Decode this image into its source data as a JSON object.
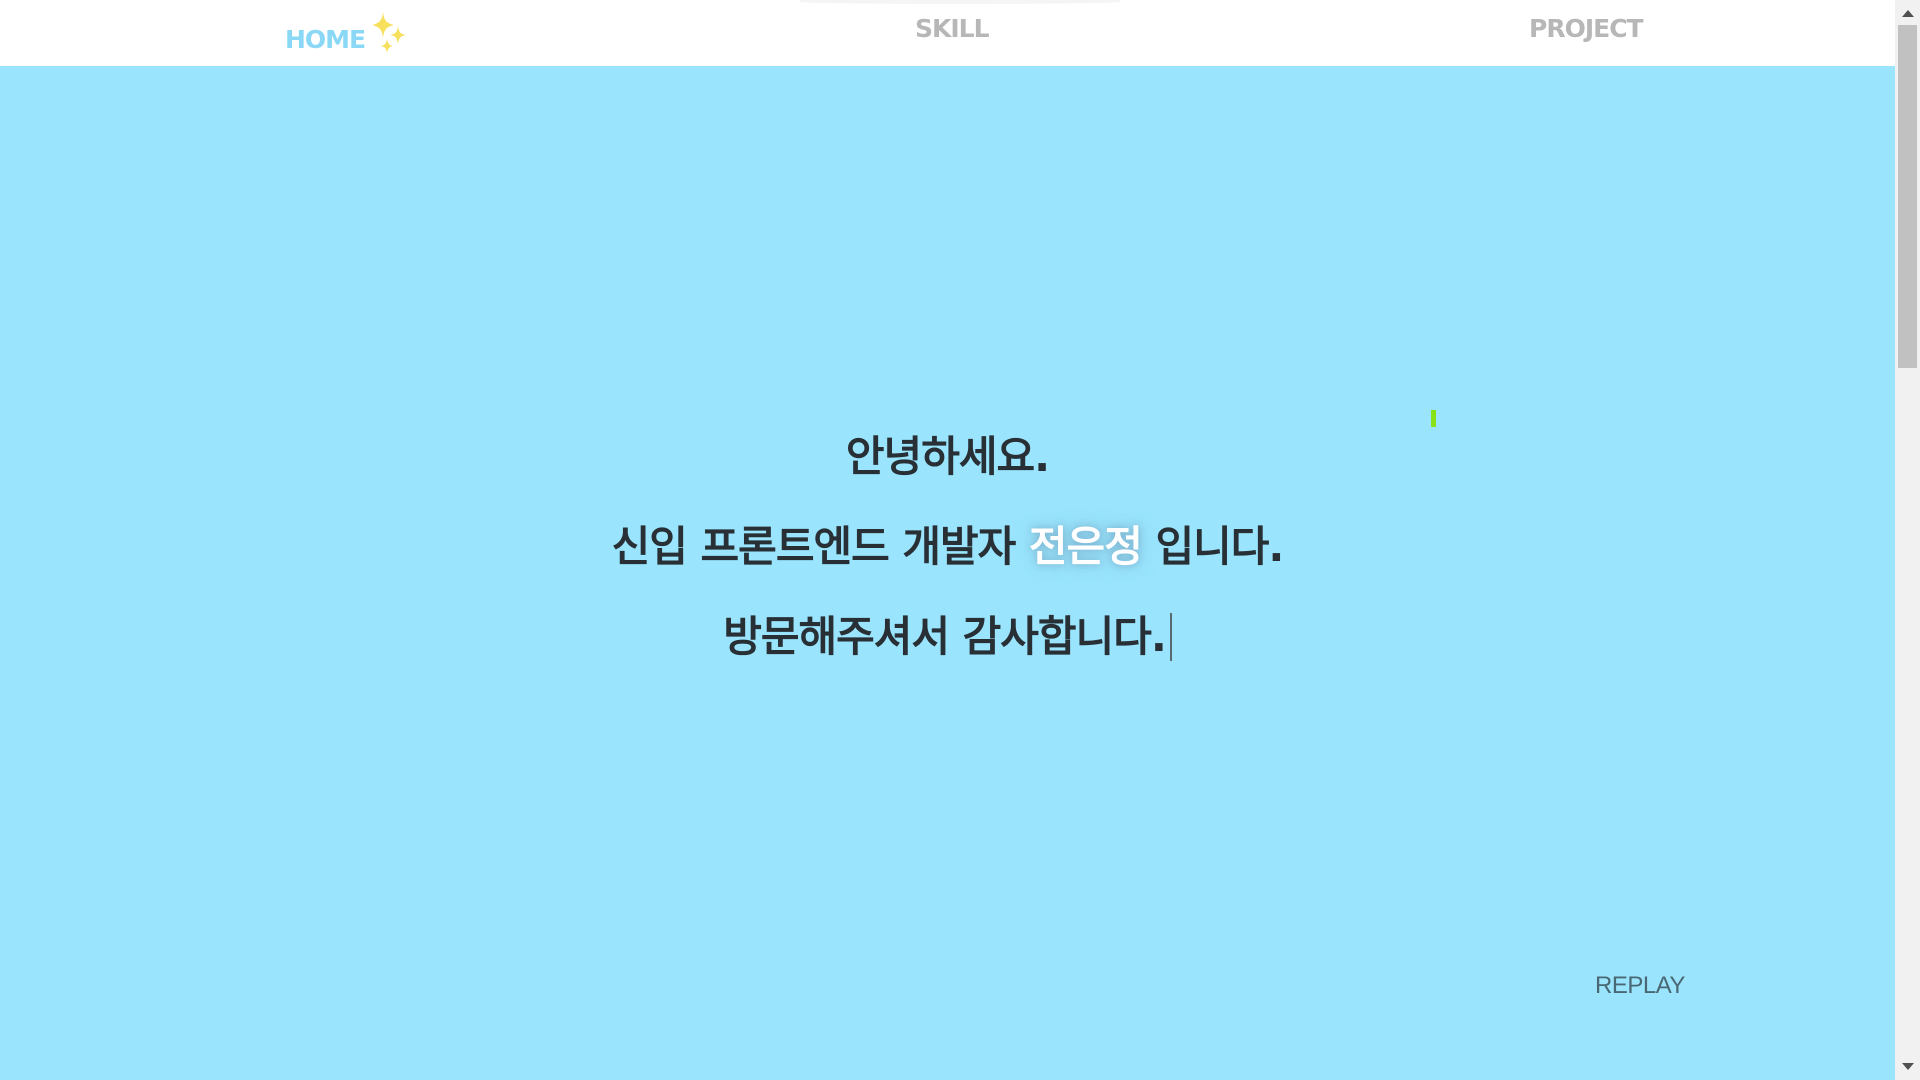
{
  "nav": {
    "items": [
      {
        "label": "HOME",
        "active": true
      },
      {
        "label": "SKILL",
        "active": false
      },
      {
        "label": "PROJECT",
        "active": false
      }
    ],
    "home_icon": "sparkles-icon"
  },
  "hero": {
    "line1": "안녕하세요.",
    "line2_prefix": "신입 프론트엔드 개발자 ",
    "line2_name": "전은정",
    "line2_suffix": " 입니다.",
    "line3": "방문해주셔서 감사합니다."
  },
  "replay_label": "REPLAY",
  "colors": {
    "background": "#9ae5fd",
    "nav_active": "#8ad8f6",
    "nav_inactive": "#b7b7b7",
    "text": "#283036",
    "sparkle": "#f7e05c",
    "marker": "#88e218"
  }
}
